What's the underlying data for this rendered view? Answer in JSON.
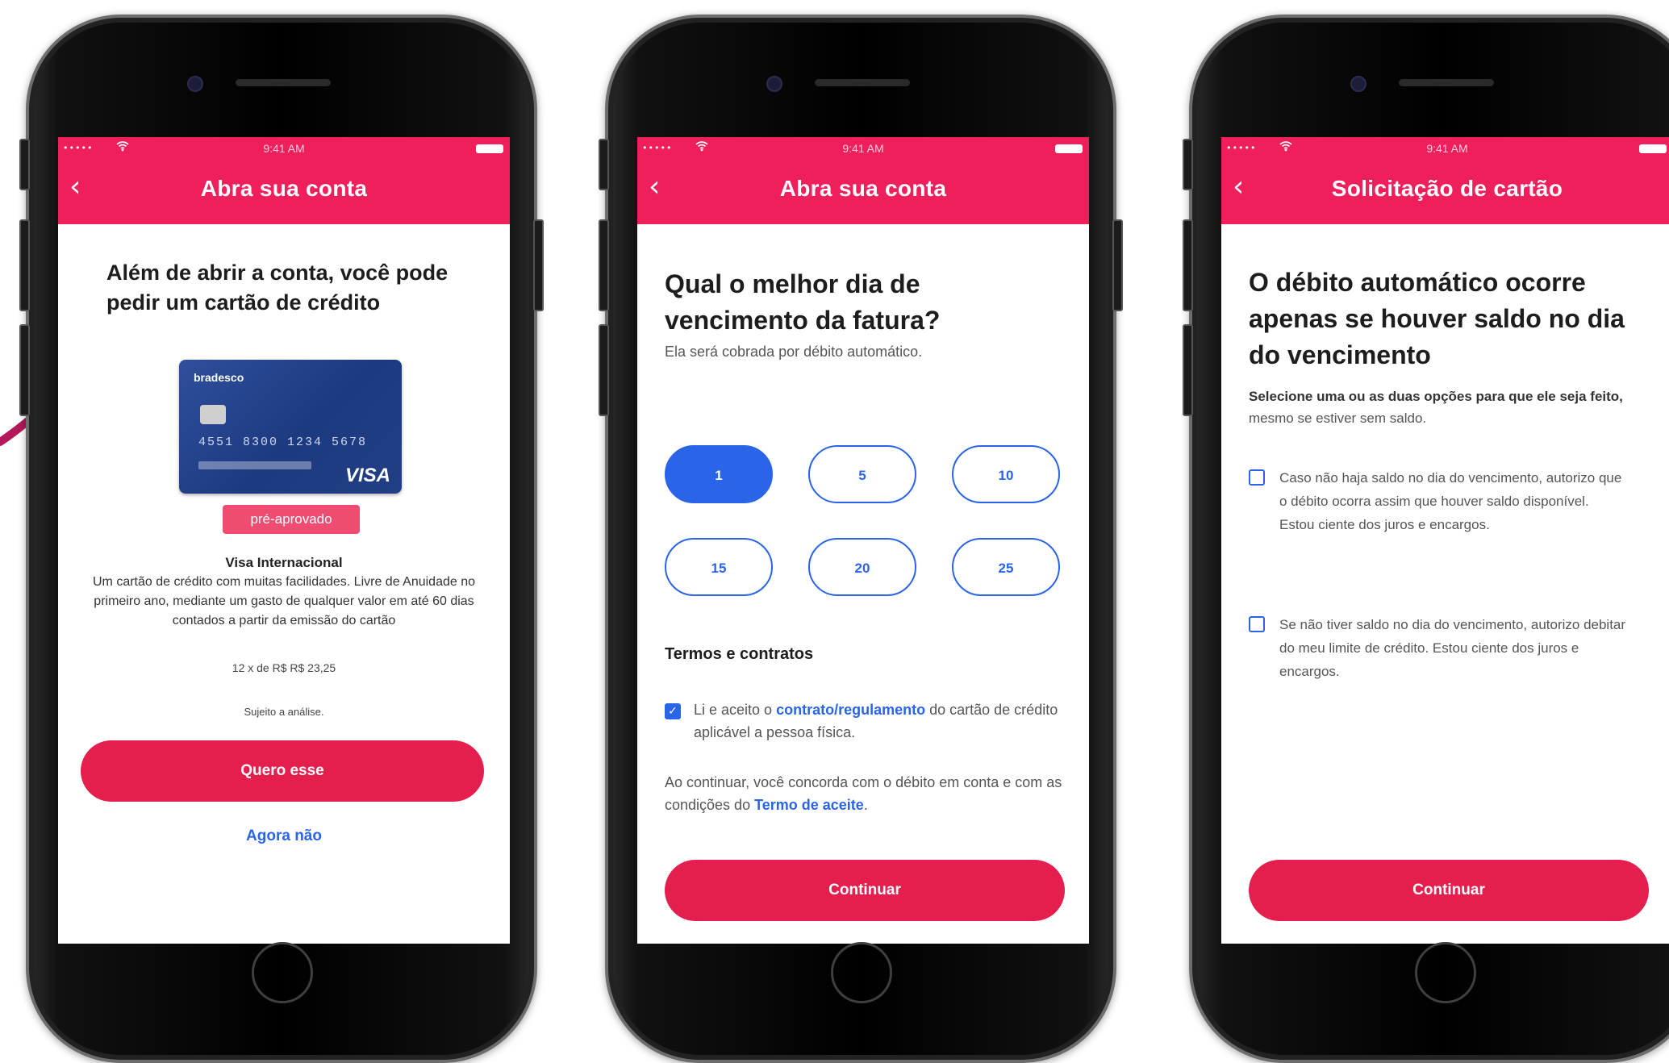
{
  "colors": {
    "brand": "#ef1f5c",
    "button": "#e41f4d",
    "accent": "#2a64e8"
  },
  "screens": [
    {
      "status": {
        "signal": "•••••",
        "wifi_icon": "wifi-icon",
        "time": "9:41 AM"
      },
      "header_title": "Abra sua conta",
      "back_icon": "‹",
      "heading": "Além de abrir a conta, você pode pedir um cartão de crédito",
      "card": {
        "brand": "bradesco",
        "number": "4551 8300 1234 5678",
        "network": "VISA",
        "badge": "pré-aprovado",
        "name": "Visa Internacional",
        "description": "Um cartão de crédito com muitas facilidades. Livre de Anuidade no primeiro ano, mediante um gasto de qualquer valor em até 60 dias contados a partir da emissão do cartão",
        "price": "12 x de R$ R$ 23,25",
        "subject": "Sujeito a análise."
      },
      "primary_button": "Quero esse",
      "secondary_link": "Agora não"
    },
    {
      "status": {
        "signal": "•••••",
        "wifi_icon": "wifi-icon",
        "time": "9:41 AM"
      },
      "header_title": "Abra sua conta",
      "back_icon": "‹",
      "heading": "Qual o melhor dia de vencimento da fatura?",
      "subtitle": "Ela será cobrada por débito automático.",
      "days": [
        "1",
        "5",
        "10",
        "15",
        "20",
        "25"
      ],
      "selected_day": "1",
      "section_title": "Termos e contratos",
      "terms": {
        "checked": true,
        "prefix": "Li e aceito o ",
        "link": "contrato/regulamento",
        "suffix": " do cartão de crédito aplicável a pessoa física."
      },
      "note": {
        "prefix": "Ao continuar, você concorda com o débito em conta e com as condições do ",
        "link": "Termo de aceite",
        "suffix": "."
      },
      "primary_button": "Continuar"
    },
    {
      "status": {
        "signal": "•••••",
        "wifi_icon": "wifi-icon",
        "time": "9:41 AM"
      },
      "header_title": "Solicitação de cartão",
      "back_icon": "‹",
      "heading": "O débito automático ocorre apenas se houver saldo no dia do vencimento",
      "subtitle_bold": "Selecione uma ou as duas opções para que ele seja feito,",
      "subtitle_rest": " mesmo se estiver sem saldo.",
      "options": [
        {
          "checked": false,
          "text": "Caso não haja saldo no dia do vencimento, autorizo que o débito ocorra assim que houver saldo disponível. Estou ciente dos juros e encargos."
        },
        {
          "checked": false,
          "text": "Se não tiver saldo no dia do vencimento, autorizo debitar do meu limite de crédito. Estou ciente dos juros e encargos."
        }
      ],
      "primary_button": "Continuar"
    }
  ]
}
